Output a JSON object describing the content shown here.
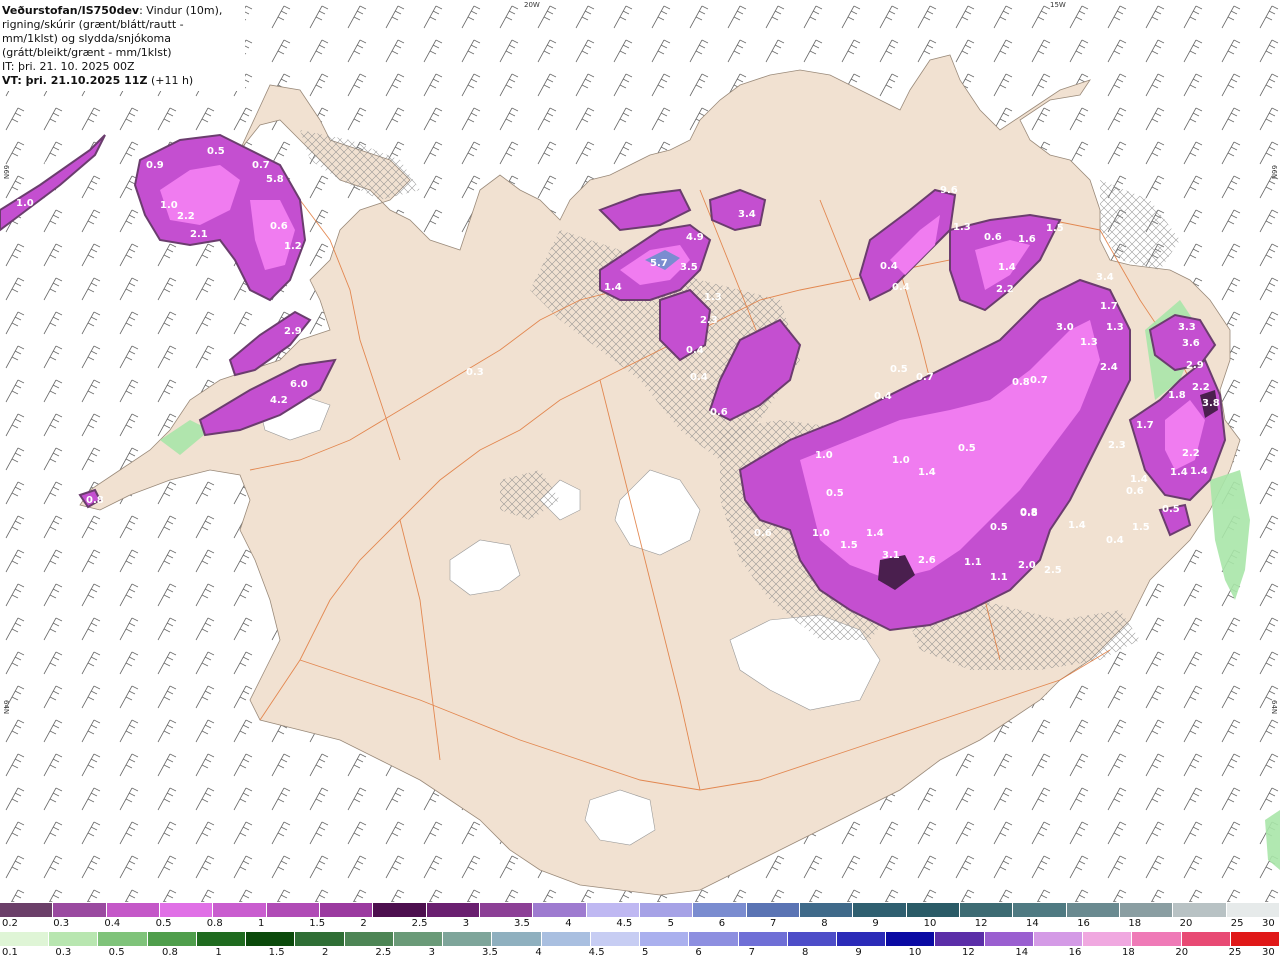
{
  "title": {
    "brand": "Veðurstofan/IS750dev",
    "desc": ": Vindur (10m), rigning/skúrir (grænt/blátt/rautt - mm/1klst) og slydda/snjókoma (grátt/bleikt/grænt - mm/1klst)",
    "it": "IT: þri. 21. 10. 2025 00Z",
    "vt_label": "VT: þri. 21.10.2025 11Z",
    "vt_offset": "(+11 h)"
  },
  "coords": {
    "top_20w": "20W",
    "top_15w": "15W",
    "left_66n": "66N",
    "right_66n": "66N",
    "left_64n": "64N",
    "right_64n": "64N"
  },
  "colors": {
    "land": "#f1e1d1",
    "sea": "#ffffff",
    "roads": "#e0783a",
    "ice": "#ffffff",
    "snow_dark": "#6b3d6e",
    "snow_mid": "#c44fd0",
    "snow_light": "#f07cf0",
    "rain_green": "#a8e6a8"
  },
  "colorbar_snow": {
    "colors": [
      "#6b3f69",
      "#9a4aa0",
      "#c458c8",
      "#e070e6",
      "#c95dcf",
      "#b04bb6",
      "#9b3aa0",
      "#4d0f4f",
      "#6a1f70",
      "#8c3f96",
      "#9e7bd0",
      "#bfb8f2",
      "#a6a2e6",
      "#7a8cd0",
      "#5a74b4",
      "#3f6a8a",
      "#2f5f70",
      "#2a5b67",
      "#3d6b73",
      "#4f7a82",
      "#6a8a90",
      "#8a9ea2",
      "#b8c2c4",
      "#e6eaea"
    ],
    "ticks": [
      "0.2",
      "0.3",
      "0.4",
      "0.5",
      "0.8",
      "1",
      "1.5",
      "2",
      "2.5",
      "3",
      "3.5",
      "4",
      "4.5",
      "5",
      "6",
      "7",
      "8",
      "9",
      "10",
      "12",
      "14",
      "16",
      "18",
      "20",
      "25",
      "30"
    ]
  },
  "colorbar_rain": {
    "colors": [
      "#dff5d6",
      "#b8e6b0",
      "#7fc37a",
      "#4f9e4c",
      "#1f6b1f",
      "#0b4a0b",
      "#2f6e35",
      "#4d8555",
      "#6a9a78",
      "#7ea59a",
      "#8fb0bf",
      "#a9bfe0",
      "#c7cdf3",
      "#aab0ee",
      "#8d8fe0",
      "#6f6fd6",
      "#4d4dc8",
      "#2b2bb8",
      "#0a0aa3",
      "#5b2ea8",
      "#9a5fd0",
      "#d49ae6",
      "#f0a8e0",
      "#ef7ab7",
      "#e84a74",
      "#e01818"
    ],
    "ticks": [
      "0.1",
      "0.3",
      "0.5",
      "0.8",
      "1",
      "1.5",
      "2",
      "2.5",
      "3",
      "3.5",
      "4",
      "4.5",
      "5",
      "6",
      "7",
      "8",
      "9",
      "10",
      "12",
      "14",
      "16",
      "18",
      "20",
      "25",
      "30"
    ]
  },
  "precip_labels": [
    {
      "t": "0.6"
    },
    {
      "t": "1.0"
    },
    {
      "t": "0.9"
    },
    {
      "t": "0.5"
    },
    {
      "t": "1.0"
    },
    {
      "t": "2.2"
    },
    {
      "t": "2.1"
    },
    {
      "t": "0.7"
    },
    {
      "t": "5.8"
    },
    {
      "t": "0.6"
    },
    {
      "t": "1.2"
    },
    {
      "t": "0.6"
    },
    {
      "t": "2.9"
    },
    {
      "t": "6.0"
    },
    {
      "t": "4.2"
    },
    {
      "t": "0.8"
    },
    {
      "t": "5.7"
    },
    {
      "t": "3.5"
    },
    {
      "t": "4.9"
    },
    {
      "t": "3.4"
    },
    {
      "t": "1.4"
    },
    {
      "t": "1.3"
    },
    {
      "t": "2.3"
    },
    {
      "t": "0.4"
    },
    {
      "t": "0.4"
    },
    {
      "t": "0.6"
    },
    {
      "t": "9.6"
    },
    {
      "t": "1.3"
    },
    {
      "t": "0.6"
    },
    {
      "t": "1.6"
    },
    {
      "t": "1.5"
    },
    {
      "t": "0.4"
    },
    {
      "t": "0.4"
    },
    {
      "t": "1.4"
    },
    {
      "t": "2.2"
    },
    {
      "t": "3.4"
    },
    {
      "t": "1.7"
    },
    {
      "t": "3.0"
    },
    {
      "t": "1.3"
    },
    {
      "t": "1.3"
    },
    {
      "t": "2.4"
    },
    {
      "t": "0.7"
    },
    {
      "t": "0.8"
    },
    {
      "t": "0.5"
    },
    {
      "t": "0.7"
    },
    {
      "t": "0.4"
    },
    {
      "t": "1.0"
    },
    {
      "t": "0.5"
    },
    {
      "t": "1.0"
    },
    {
      "t": "1.4"
    },
    {
      "t": "0.5"
    },
    {
      "t": "0.8"
    },
    {
      "t": "0.6"
    },
    {
      "t": "1.0"
    },
    {
      "t": "1.5"
    },
    {
      "t": "1.4"
    },
    {
      "t": "3.1"
    },
    {
      "t": "2.6"
    },
    {
      "t": "1.1"
    },
    {
      "t": "1.1"
    },
    {
      "t": "2.0"
    },
    {
      "t": "2.5"
    },
    {
      "t": "0.5"
    },
    {
      "t": "0.8"
    },
    {
      "t": "1.4"
    },
    {
      "t": "3.3"
    },
    {
      "t": "3.6"
    },
    {
      "t": "2.9"
    },
    {
      "t": "2.2"
    },
    {
      "t": "3.8"
    },
    {
      "t": "1.8"
    },
    {
      "t": "1.7"
    },
    {
      "t": "2.3"
    },
    {
      "t": "2.2"
    },
    {
      "t": "1.4"
    },
    {
      "t": "1.4"
    },
    {
      "t": "0.6"
    },
    {
      "t": "1.5"
    },
    {
      "t": "0.4"
    },
    {
      "t": "0.5"
    },
    {
      "t": "1.4"
    },
    {
      "t": "0.2"
    },
    {
      "t": "0.3"
    }
  ]
}
